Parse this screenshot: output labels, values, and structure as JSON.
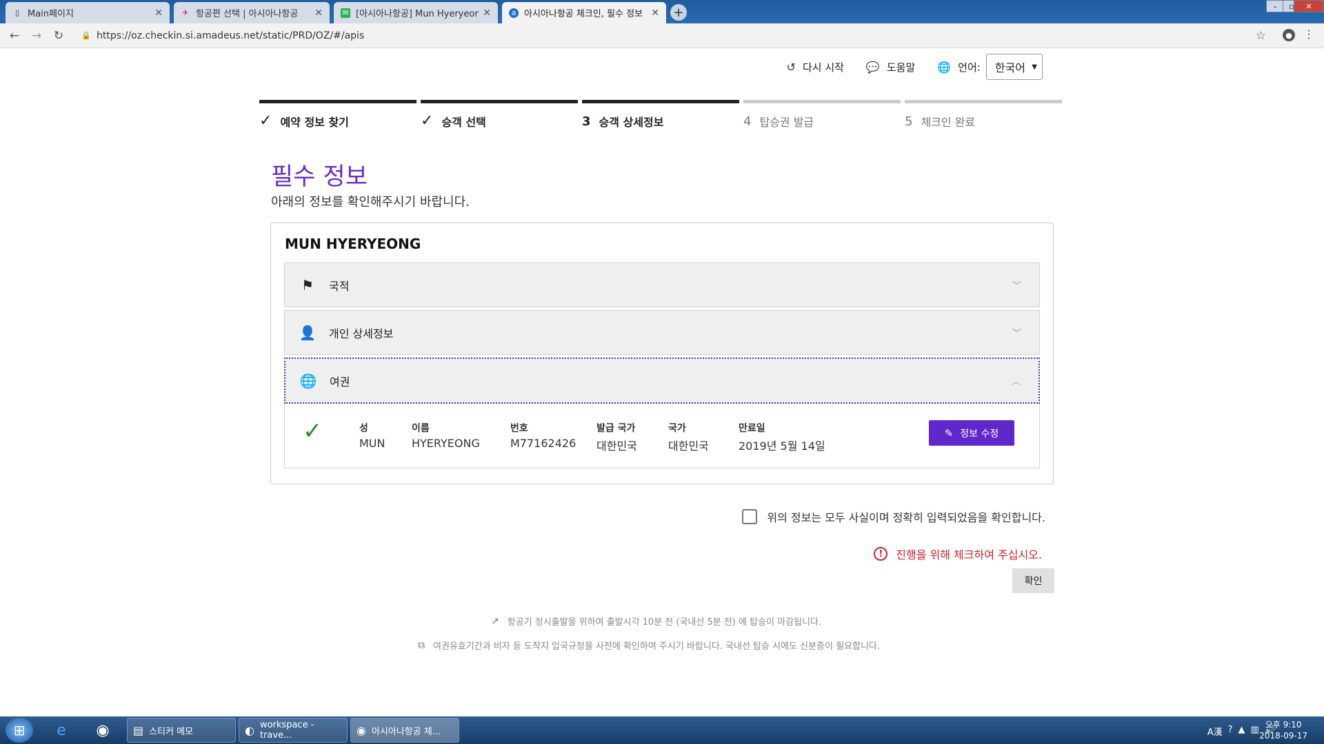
{
  "browser": {
    "tabs": [
      {
        "title": "Main페이지",
        "icon": "page-icon",
        "active": false
      },
      {
        "title": "항공편 선택 | 아시아나항공",
        "icon": "asiana-logo-icon",
        "active": false
      },
      {
        "title": "[아시아나항공] Mun Hyeryeong",
        "icon": "mail-icon",
        "active": false
      },
      {
        "title": "아시아나항공 체크인, 필수 정보",
        "icon": "amadeus-icon",
        "active": true
      }
    ],
    "url": "https://oz.checkin.si.amadeus.net/static/PRD/OZ/#/apis"
  },
  "topnav": {
    "restart": "다시 시작",
    "help": "도움말",
    "language_label": "언어:",
    "language_value": "한국어"
  },
  "steps": [
    {
      "number": "",
      "label": "예약 정보 찾기",
      "state": "done"
    },
    {
      "number": "",
      "label": "승객 선택",
      "state": "done"
    },
    {
      "number": "3",
      "label": "승객 상세정보",
      "state": "current"
    },
    {
      "number": "4",
      "label": "탑승권 발급",
      "state": "future"
    },
    {
      "number": "5",
      "label": "체크인 완료",
      "state": "future"
    }
  ],
  "page": {
    "title": "필수 정보",
    "subtitle": "아래의 정보를 확인해주시기 바랍니다."
  },
  "passenger": {
    "name": "MUN HYERYEONG",
    "sections": [
      {
        "label": "국적",
        "icon": "flag-icon"
      },
      {
        "label": "개인 상세정보",
        "icon": "person-icon"
      },
      {
        "label": "여권",
        "icon": "globe-icon"
      }
    ],
    "passport": {
      "surname_label": "성",
      "surname": "MUN",
      "given_label": "이름",
      "given": "HYERYEONG",
      "number_label": "번호",
      "number": "M77162426",
      "issuing_label": "발급 국가",
      "issuing": "대한민국",
      "country_label": "국가",
      "country": "대한민국",
      "expiry_label": "만료일",
      "expiry": "2019년 5월 14일",
      "edit_button": "정보 수정"
    }
  },
  "confirm": {
    "checkbox_label": "위의 정보는 모두 사실이며 정확히 입력되었음을 확인합니다.",
    "error": "진행을 위해 체크하여 주십시오.",
    "button": "확인"
  },
  "notes": [
    "항공기 정시출발을 위하여 출발시각 10분 전 (국내선 5분 전) 에 탑승이 마감됩니다.",
    "여권유효기간과 비자 등 도착지 입국규정을 사전에 확인하여 주시기 바랍니다. 국내선 탑승 시에도 신분증이 필요합니다."
  ],
  "taskbar": {
    "tasks": [
      {
        "title": "스티커 메모",
        "icon": "sticky-note-icon"
      },
      {
        "title": "workspace - trave...",
        "icon": "eclipse-icon"
      },
      {
        "title": "아시아나항공 체...",
        "icon": "chrome-icon"
      }
    ],
    "time": "오후 9:10",
    "date": "2018-09-17"
  },
  "colors": {
    "accent": "#6027cc",
    "title": "#6a2cc4",
    "error": "#d0202a",
    "success": "#2a8a2a"
  }
}
